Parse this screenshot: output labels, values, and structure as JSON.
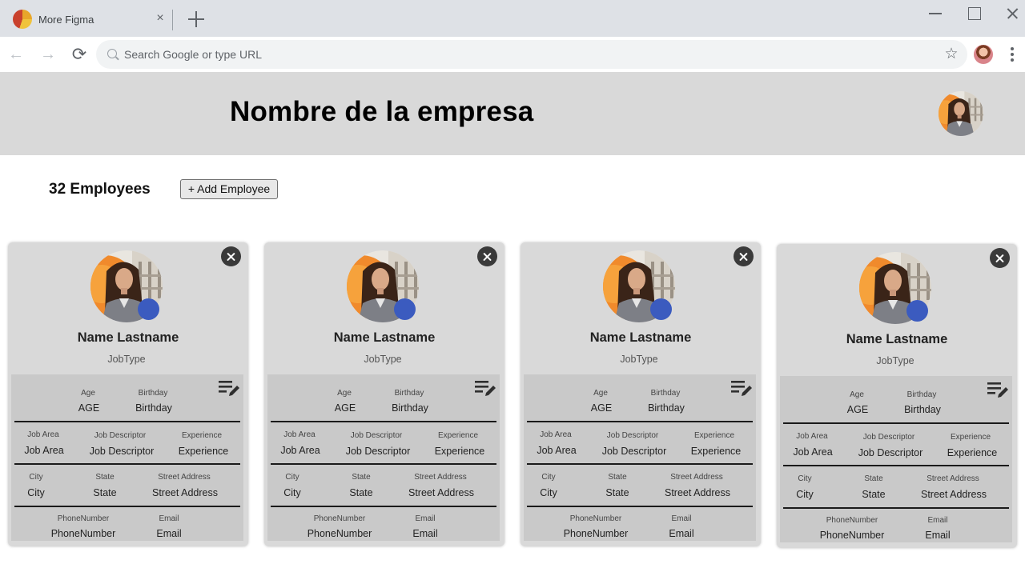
{
  "browser": {
    "tab_title": "More Figma",
    "tab_close": "×",
    "omnibox_placeholder": "Search Google or type URL",
    "back_icon": "←",
    "forward_icon": "→",
    "reload_icon": "⟳",
    "star_icon": "☆"
  },
  "header": {
    "company_name": "Nombre de la empresa"
  },
  "summary": {
    "employee_count": "32 Employees",
    "add_button": "+ Add Employee"
  },
  "colors": {
    "header_bg": "#d9d9d9",
    "card_bg": "#d9d9d9",
    "details_bg": "#c9c9c9",
    "status_dot": "#3b5bbf"
  },
  "cards": [
    {
      "name": "Name Lastname",
      "job_type": "JobType",
      "age_label": "Age",
      "age": "AGE",
      "birthday_label": "Birthday",
      "birthday": "Birthday",
      "job_area_label": "Job Area",
      "job_area": "Job Area",
      "job_descriptor_label": "Job Descriptor",
      "job_descriptor": "Job Descriptor",
      "experience_label": "Experience",
      "experience": "Experience",
      "city_label": "City",
      "city": "City",
      "state_label": "State",
      "state": "State",
      "street_label": "Street Address",
      "street": "Street Address",
      "phone_label": "PhoneNumber",
      "phone": "PhoneNumber",
      "email_label": "Email",
      "email": "Email"
    },
    {
      "name": "Name Lastname",
      "job_type": "JobType",
      "age_label": "Age",
      "age": "AGE",
      "birthday_label": "Birthday",
      "birthday": "Birthday",
      "job_area_label": "Job Area",
      "job_area": "Job Area",
      "job_descriptor_label": "Job Descriptor",
      "job_descriptor": "Job Descriptor",
      "experience_label": "Experience",
      "experience": "Experience",
      "city_label": "City",
      "city": "City",
      "state_label": "State",
      "state": "State",
      "street_label": "Street Address",
      "street": "Street Address",
      "phone_label": "PhoneNumber",
      "phone": "PhoneNumber",
      "email_label": "Email",
      "email": "Email"
    },
    {
      "name": "Name Lastname",
      "job_type": "JobType",
      "age_label": "Age",
      "age": "AGE",
      "birthday_label": "Birthday",
      "birthday": "Birthday",
      "job_area_label": "Job Area",
      "job_area": "Job Area",
      "job_descriptor_label": "Job Descriptor",
      "job_descriptor": "Job Descriptor",
      "experience_label": "Experience",
      "experience": "Experience",
      "city_label": "City",
      "city": "City",
      "state_label": "State",
      "state": "State",
      "street_label": "Street Address",
      "street": "Street Address",
      "phone_label": "PhoneNumber",
      "phone": "PhoneNumber",
      "email_label": "Email",
      "email": "Email"
    },
    {
      "name": "Name Lastname",
      "job_type": "JobType",
      "age_label": "Age",
      "age": "AGE",
      "birthday_label": "Birthday",
      "birthday": "Birthday",
      "job_area_label": "Job Area",
      "job_area": "Job Area",
      "job_descriptor_label": "Job Descriptor",
      "job_descriptor": "Job Descriptor",
      "experience_label": "Experience",
      "experience": "Experience",
      "city_label": "City",
      "city": "City",
      "state_label": "State",
      "state": "State",
      "street_label": "Street Address",
      "street": "Street Address",
      "phone_label": "PhoneNumber",
      "phone": "PhoneNumber",
      "email_label": "Email",
      "email": "Email"
    }
  ]
}
